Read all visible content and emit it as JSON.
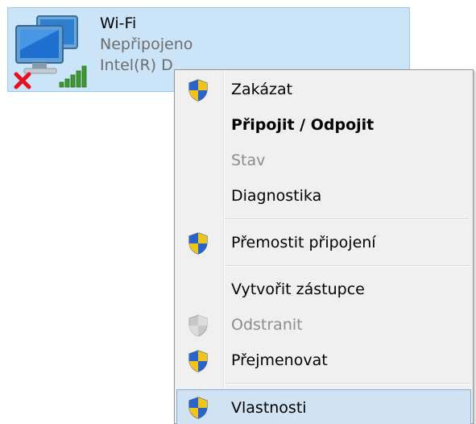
{
  "adapter": {
    "name": "Wi-Fi",
    "status": "Nepřipojeno",
    "device": "Intel(R) D"
  },
  "context_menu": {
    "items": [
      {
        "label": "Zakázat",
        "icon": "uac-shield-icon",
        "bold": false,
        "disabled": false
      },
      {
        "label": "Připojit / Odpojit",
        "icon": null,
        "bold": true,
        "disabled": false
      },
      {
        "label": "Stav",
        "icon": null,
        "bold": false,
        "disabled": true
      },
      {
        "label": "Diagnostika",
        "icon": null,
        "bold": false,
        "disabled": false
      },
      {
        "label": "Přemostit připojení",
        "icon": "uac-shield-icon",
        "bold": false,
        "disabled": false
      },
      {
        "label": "Vytvořit zástupce",
        "icon": null,
        "bold": false,
        "disabled": false
      },
      {
        "label": "Odstranit",
        "icon": "uac-shield-icon",
        "bold": false,
        "disabled": true
      },
      {
        "label": "Přejmenovat",
        "icon": "uac-shield-icon",
        "bold": false,
        "disabled": false
      },
      {
        "label": "Vlastnosti",
        "icon": "uac-shield-icon",
        "bold": false,
        "disabled": false,
        "highlighted": true
      }
    ]
  },
  "colors": {
    "selection_background": "#cce4f7",
    "menu_background": "#f0f0f0",
    "highlight_background": "#d1e2f2",
    "disabled_text": "#8d8d8d",
    "error_red": "#e81123",
    "signal_green": "#3c9a2f"
  }
}
